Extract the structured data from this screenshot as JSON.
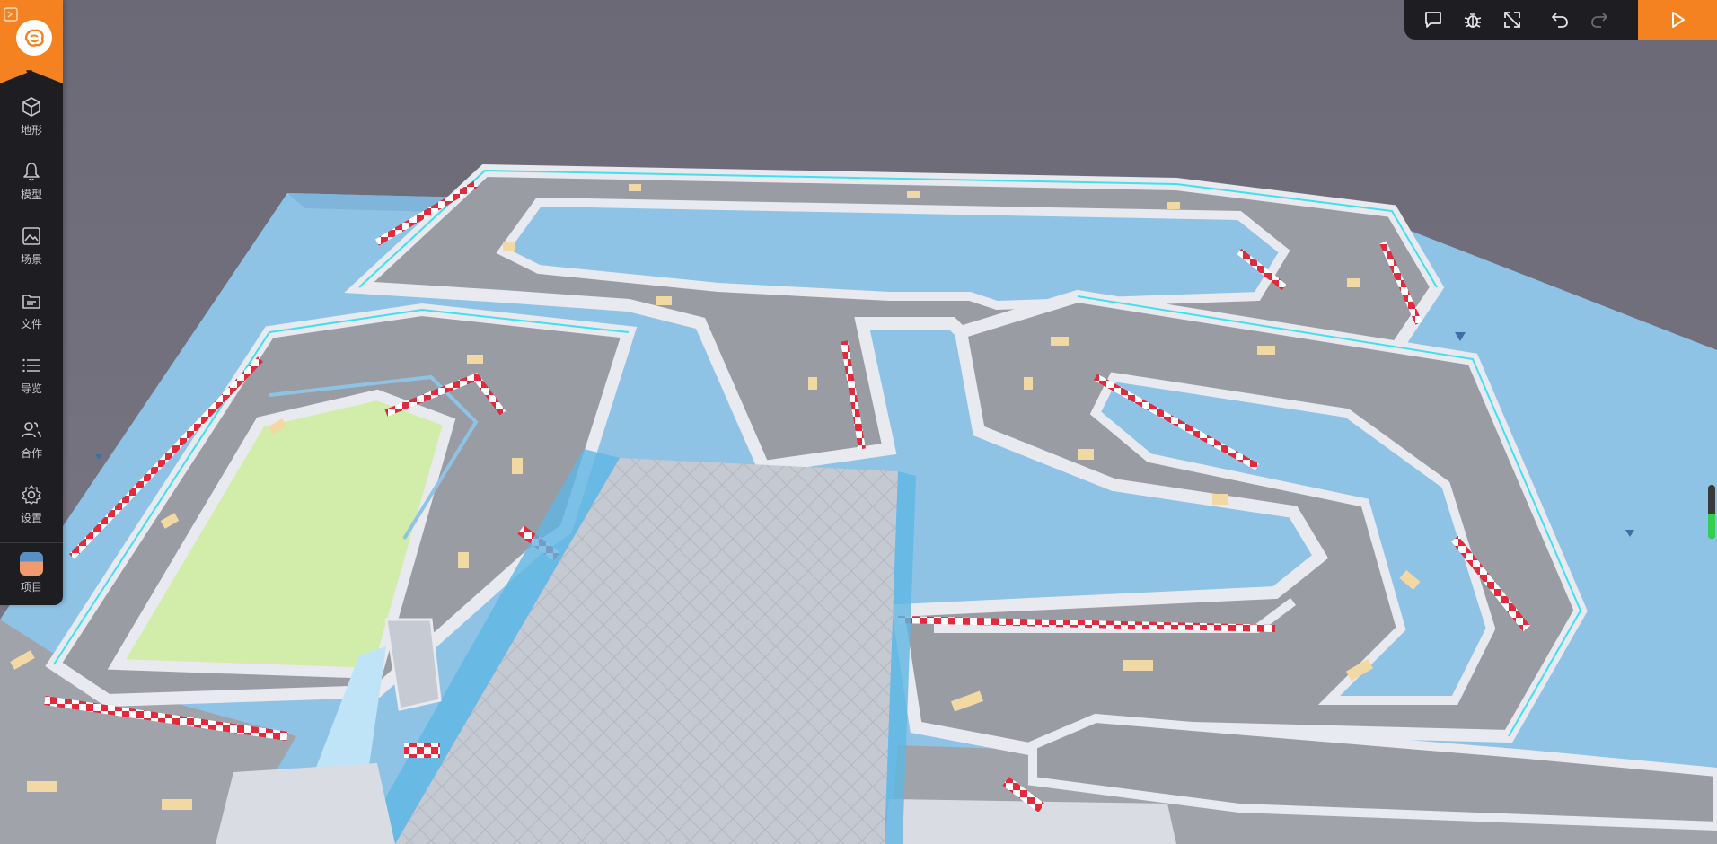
{
  "sidebar": {
    "items": [
      {
        "id": "terrain",
        "label": "地形",
        "icon": "cube-icon"
      },
      {
        "id": "model",
        "label": "模型",
        "icon": "bell-icon"
      },
      {
        "id": "scene",
        "label": "场景",
        "icon": "image-icon"
      },
      {
        "id": "files",
        "label": "文件",
        "icon": "folder-icon"
      },
      {
        "id": "navigator",
        "label": "导览",
        "icon": "list-icon"
      },
      {
        "id": "collab",
        "label": "合作",
        "icon": "users-icon"
      },
      {
        "id": "settings",
        "label": "设置",
        "icon": "gear-icon"
      },
      {
        "id": "project",
        "label": "项目",
        "icon": "project-avatar"
      }
    ]
  },
  "toolbar": {
    "buttons": [
      "comment-icon",
      "bug-icon",
      "expand-icon",
      "undo-icon",
      "redo-icon",
      "play-icon"
    ]
  },
  "viewport": {
    "gauge_level": 0.45
  },
  "colors": {
    "accent": "#f58220",
    "panel": "#1e1e22",
    "sky": "#6e6c78",
    "water": "#8ec3e6",
    "track": "#9a9ca4",
    "curb_red": "#e5283a",
    "grass": "#d2ecaa"
  }
}
